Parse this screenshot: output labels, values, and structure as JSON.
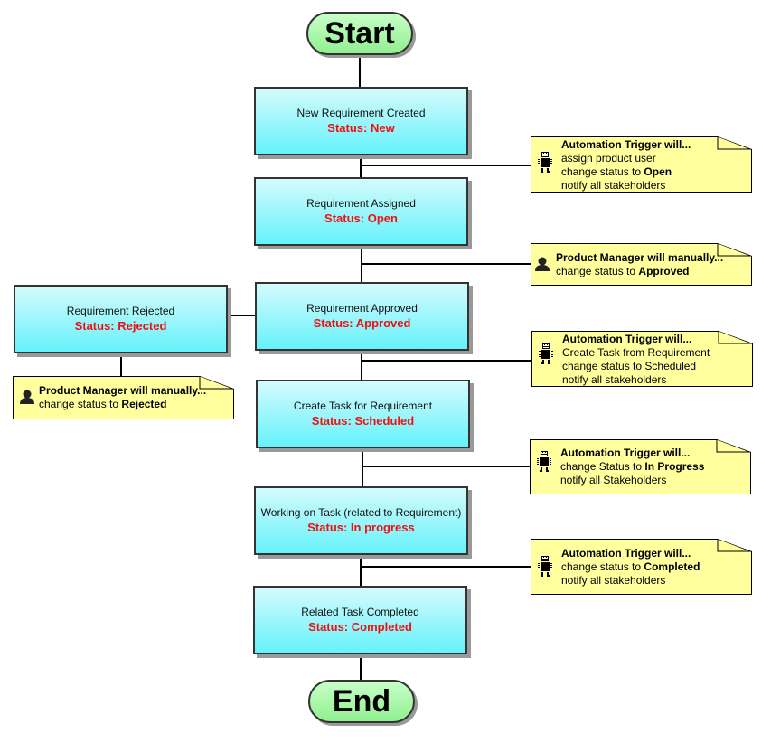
{
  "diagram": {
    "start_label": "Start",
    "end_label": "End",
    "nodes": [
      {
        "title": "New Requirement Created",
        "status": "Status: New"
      },
      {
        "title": "Requirement Assigned",
        "status": "Status: Open"
      },
      {
        "title": "Requirement Approved",
        "status": "Status: Approved"
      },
      {
        "title": "Create Task for Requirement",
        "status": "Status: Scheduled"
      },
      {
        "title": "Working on Task (related to Requirement)",
        "status": "Status: In progress"
      },
      {
        "title": "Related Task Completed",
        "status": "Status: Completed"
      },
      {
        "title": "Requirement Rejected",
        "status": "Status: Rejected"
      }
    ],
    "notes": [
      {
        "icon": "robot-icon",
        "head": "Automation Trigger will...",
        "lines": [
          "assign product user"
        ],
        "line2_pre": "change status to ",
        "line2_bold": "Open",
        "line3": "notify all stakeholders"
      },
      {
        "icon": "person-icon",
        "head": "Product Manager will manually...",
        "line2_pre": "change status to ",
        "line2_bold": "Approved"
      },
      {
        "icon": "robot-icon",
        "head": "Automation Trigger will...",
        "lines": [
          "Create Task from Requirement"
        ],
        "line2_pre": "change status to Scheduled",
        "line3": "notify all stakeholders"
      },
      {
        "icon": "robot-icon",
        "head": "Automation Trigger will...",
        "line2_pre": "change Status to ",
        "line2_bold": "In Progress",
        "line3": "notify all Stakeholders"
      },
      {
        "icon": "robot-icon",
        "head": "Automation Trigger will...",
        "line2_pre": "change status to ",
        "line2_bold": "Completed",
        "line3": "notify all stakeholders"
      },
      {
        "icon": "person-icon",
        "head": "Product Manager will manually...",
        "line2_pre": "change status to ",
        "line2_bold": "Rejected"
      }
    ]
  }
}
